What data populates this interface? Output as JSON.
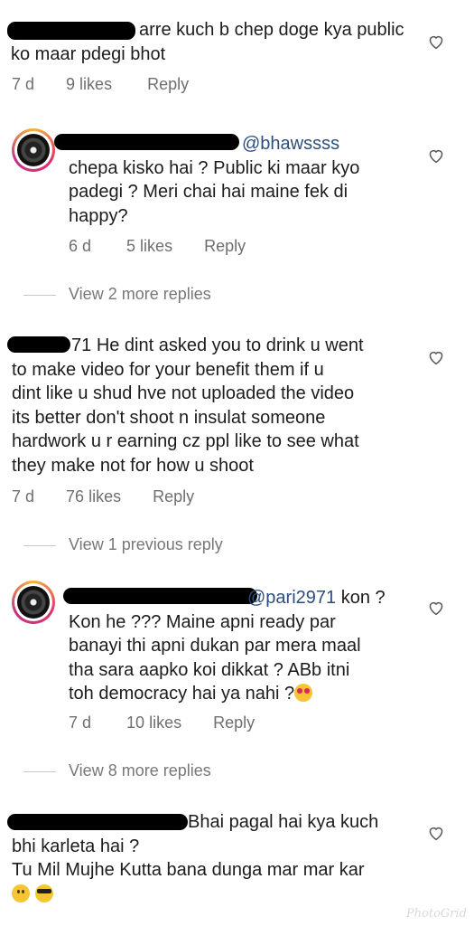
{
  "comments": [
    {
      "lines": [
        "arre kuch b chep doge kya public",
        "ko maar pdegi bhot"
      ],
      "time": "7 d",
      "likes": "9 likes",
      "reply": "Reply"
    },
    {
      "mention": "@bhawssss",
      "lines": [
        "chepa kisko hai ? Public ki maar kyo",
        "padegi ? Meri chai hai maine fek di",
        "happy?"
      ],
      "time": "6 d",
      "likes": "5 likes",
      "reply": "Reply"
    },
    {
      "thread": "View 2 more replies"
    },
    {
      "lead": "71",
      "lines": [
        "He dint asked you to drink u went",
        "to make video for your benefit them if u",
        "dint like u shud hve not uploaded the video",
        "its better don't shoot n insulat someone",
        "hardwork u r earning cz ppl like to see what",
        "they make not for how u shoot"
      ],
      "time": "7 d",
      "likes": "76 likes",
      "reply": "Reply"
    },
    {
      "thread": "View 1 previous reply"
    },
    {
      "mention": "@pari2971",
      "after_mention": "kon ?",
      "lines": [
        "Kon he ??? Maine apni ready par",
        "banayi thi apni dukan par mera maal",
        "tha sara aapko koi dikkat ? ABb itni",
        "toh democracy hai ya nahi ?"
      ],
      "time": "7 d",
      "likes": "10 likes",
      "reply": "Reply"
    },
    {
      "thread": "View 8 more replies"
    },
    {
      "lines": [
        "Bhai pagal hai kya kuch",
        "bhi karleta hai ?",
        "Tu Mil Mujhe Kutta bana dunga mar mar kar"
      ]
    }
  ],
  "watermark": "PhotoGrid",
  "icons": {
    "like": "heart-outline-icon"
  }
}
